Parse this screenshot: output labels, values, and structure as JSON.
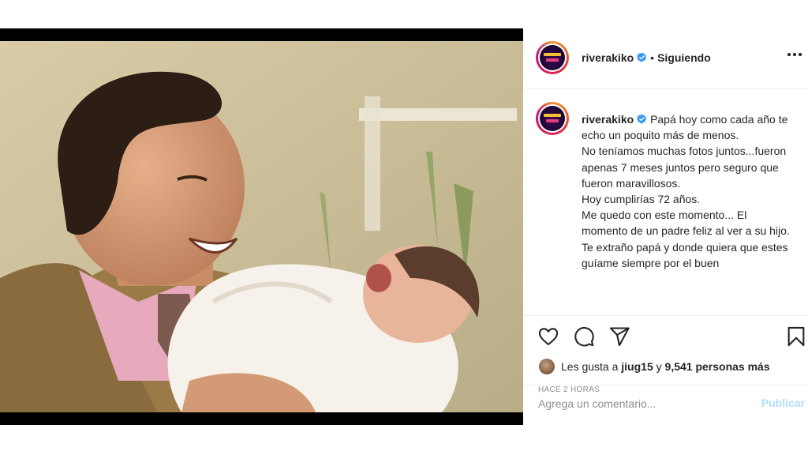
{
  "post": {
    "username": "riverakiko",
    "separator": "•",
    "follow_status": "Siguiendo",
    "caption_lines": [
      "Papá hoy como cada año te echo un poquito más de menos.",
      "No teníamos muchas fotos juntos...fueron apenas 7 meses juntos pero seguro que fueron maravillosos.",
      "Hoy cumplirías 72 años.",
      "Me quedo con este momento... El momento de un padre feliz al ver a su hijo.",
      "Te extraño papá y donde quiera que estes guíame siempre por el buen"
    ],
    "likes": {
      "prefix": "Les gusta a",
      "user": "jiug15",
      "middle": "y",
      "others": "9,541 personas más"
    },
    "timestamp": "HACE 2 HORAS",
    "comment_placeholder": "Agrega un comentario...",
    "publish_label": "Publicar"
  },
  "icons": {
    "verified": "verified-badge-icon",
    "more": "more-options-icon",
    "like": "heart-icon",
    "comment": "comment-icon",
    "share": "share-icon",
    "save": "bookmark-icon"
  },
  "colors": {
    "verified_blue": "#3897f0",
    "publish_disabled": "#b2dffc",
    "muted": "#8e8e8e"
  }
}
